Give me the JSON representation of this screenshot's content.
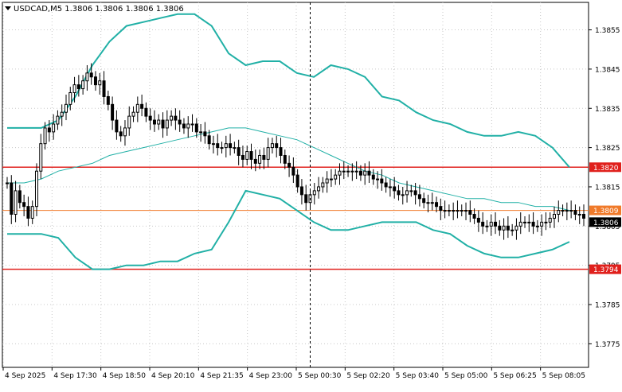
{
  "header": {
    "symbol_title": "USDCAD,M5  1.3806 1.3806 1.3806 1.3806"
  },
  "chart_data": {
    "type": "candlestick",
    "symbol": "USDCAD",
    "timeframe": "M5",
    "ohlc_readout": {
      "open": 1.3806,
      "high": 1.3806,
      "low": 1.3806,
      "close": 1.3806
    },
    "ylim": [
      1.3769,
      1.3862
    ],
    "y_ticks": [
      1.3855,
      1.3845,
      1.3835,
      1.3825,
      1.3815,
      1.3805,
      1.3795,
      1.3785,
      1.3775
    ],
    "x_tick_labels": [
      "4 Sep 2025",
      "4 Sep 17:30",
      "4 Sep 18:50",
      "4 Sep 20:10",
      "4 Sep 21:35",
      "4 Sep 23:00",
      "5 Sep 00:30",
      "5 Sep 02:20",
      "5 Sep 03:40",
      "5 Sep 05:00",
      "5 Sep 06:25",
      "5 Sep 08:05"
    ],
    "horizontal_lines": [
      {
        "price": 1.382,
        "label": "1.3820",
        "color": "#e0201c"
      },
      {
        "price": 1.3809,
        "label": "1.3809",
        "color": "#f07a2a"
      },
      {
        "price": 1.3794,
        "label": "1.3794",
        "color": "#e0201c"
      }
    ],
    "current_price": {
      "price": 1.3806,
      "label": "1.3806"
    },
    "crosshair_x_index": 72,
    "colors": {
      "bands": "#21b0a6",
      "candle": "#000000",
      "grid": "#c8c8c8",
      "label_bg": "#e0201c",
      "current_bg": "#000000"
    },
    "closes": [
      1.3816,
      1.3808,
      1.3814,
      1.3811,
      1.381,
      1.3807,
      1.381,
      1.3819,
      1.3826,
      1.383,
      1.3829,
      1.3831,
      1.3833,
      1.3834,
      1.3836,
      1.3839,
      1.3841,
      1.384,
      1.3842,
      1.3844,
      1.3843,
      1.3841,
      1.3842,
      1.3838,
      1.3836,
      1.3832,
      1.3829,
      1.3828,
      1.383,
      1.3833,
      1.3834,
      1.3836,
      1.3835,
      1.3833,
      1.3832,
      1.3831,
      1.3832,
      1.383,
      1.3832,
      1.3833,
      1.3832,
      1.3831,
      1.383,
      1.3831,
      1.3831,
      1.3829,
      1.3829,
      1.3828,
      1.3826,
      1.3826,
      1.3825,
      1.3825,
      1.3826,
      1.3825,
      1.3825,
      1.3823,
      1.3822,
      1.3824,
      1.3822,
      1.3821,
      1.3823,
      1.3822,
      1.3825,
      1.3826,
      1.3825,
      1.3823,
      1.3821,
      1.382,
      1.3818,
      1.3815,
      1.3813,
      1.3811,
      1.3813,
      1.3814,
      1.3815,
      1.3816,
      1.3817,
      1.3817,
      1.3818,
      1.3819,
      1.3819,
      1.3819,
      1.3819,
      1.3819,
      1.3818,
      1.3819,
      1.3818,
      1.3817,
      1.3817,
      1.3816,
      1.3815,
      1.3815,
      1.3814,
      1.3813,
      1.3813,
      1.3814,
      1.3814,
      1.3813,
      1.3812,
      1.3811,
      1.3811,
      1.3811,
      1.381,
      1.3809,
      1.3809,
      1.3809,
      1.3809,
      1.3809,
      1.3809,
      1.3809,
      1.3808,
      1.3807,
      1.3806,
      1.3805,
      1.3805,
      1.3806,
      1.3805,
      1.3804,
      1.3805,
      1.3804,
      1.3804,
      1.3805,
      1.3806,
      1.3806,
      1.3806,
      1.3805,
      1.3805,
      1.3806,
      1.3806,
      1.3807,
      1.3808,
      1.3809,
      1.3809,
      1.3809,
      1.3809,
      1.3808,
      1.3808,
      1.3807
    ],
    "upper_band": [
      1.383,
      1.383,
      1.383,
      1.3832,
      1.3838,
      1.3846,
      1.3852,
      1.3856,
      1.3857,
      1.3858,
      1.3859,
      1.3859,
      1.3856,
      1.3849,
      1.3846,
      1.3847,
      1.3847,
      1.3844,
      1.3843,
      1.3846,
      1.3845,
      1.3843,
      1.3838,
      1.3837,
      1.3834,
      1.3832,
      1.3831,
      1.3829,
      1.3828,
      1.3828,
      1.3829,
      1.3828,
      1.3825,
      1.382
    ],
    "middle_band": [
      1.3816,
      1.3816,
      1.3817,
      1.3819,
      1.382,
      1.3821,
      1.3823,
      1.3824,
      1.3825,
      1.3826,
      1.3827,
      1.3828,
      1.3829,
      1.383,
      1.383,
      1.3829,
      1.3828,
      1.3827,
      1.3825,
      1.3823,
      1.3821,
      1.3819,
      1.3818,
      1.3816,
      1.3815,
      1.3814,
      1.3813,
      1.3812,
      1.3812,
      1.3811,
      1.3811,
      1.381,
      1.381,
      1.3809
    ],
    "lower_band": [
      1.3803,
      1.3803,
      1.3803,
      1.3802,
      1.3797,
      1.3794,
      1.3794,
      1.3795,
      1.3795,
      1.3796,
      1.3796,
      1.3798,
      1.3799,
      1.3806,
      1.3814,
      1.3813,
      1.3812,
      1.3809,
      1.3806,
      1.3804,
      1.3804,
      1.3805,
      1.3806,
      1.3806,
      1.3806,
      1.3804,
      1.3803,
      1.38,
      1.3798,
      1.3797,
      1.3797,
      1.3798,
      1.3799,
      1.3801
    ]
  }
}
